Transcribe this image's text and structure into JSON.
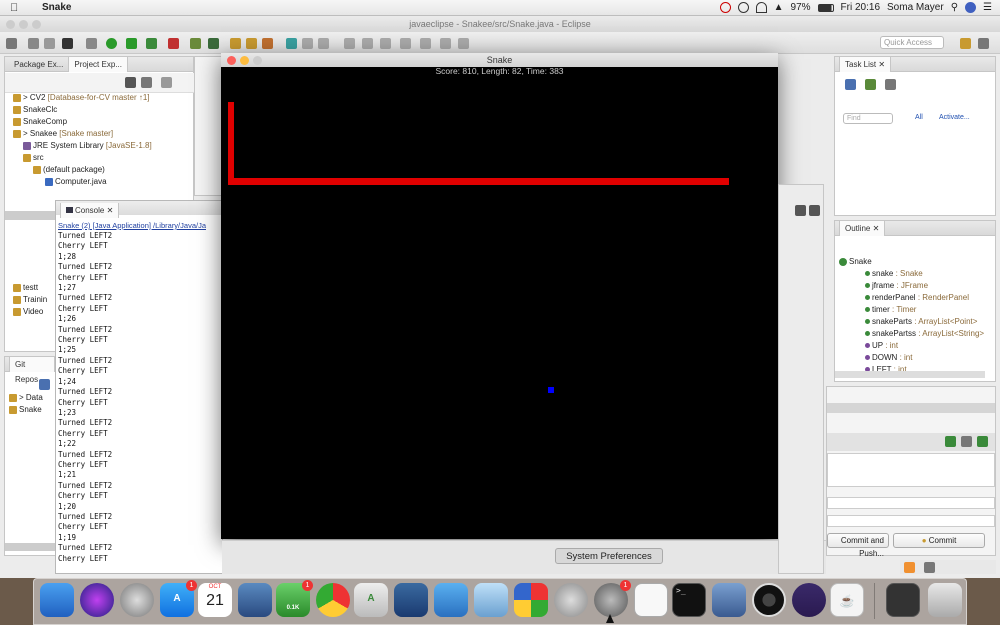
{
  "menubar": {
    "app_name": "Snake",
    "battery": "97%",
    "clock": "Fri 20:16",
    "user": "Soma Mayer"
  },
  "eclipse": {
    "window_title": "javaeclipse - Snakee/src/Snake.java - Eclipse",
    "quick_access": "Quick Access"
  },
  "package_explorer": {
    "tabs": [
      "Package Ex...",
      "Project Exp..."
    ],
    "rows": [
      {
        "label": "> CV2",
        "meta": "[Database-for-CV master ↑1]"
      },
      {
        "label": "SnakeClc",
        "meta": ""
      },
      {
        "label": "SnakeComp",
        "meta": ""
      },
      {
        "label": "> Snakee",
        "meta": "[Snake master]"
      },
      {
        "label": "JRE System Library",
        "meta": "[JavaSE-1.8]"
      },
      {
        "label": "src",
        "meta": ""
      },
      {
        "label": "(default package)",
        "meta": ""
      },
      {
        "label": "Computer.java",
        "meta": ""
      }
    ],
    "lower_rows": [
      "testt",
      "Trainin",
      "Video"
    ]
  },
  "git": {
    "tab": "Git Repos",
    "rows": [
      "> Data",
      "Snake"
    ]
  },
  "console": {
    "tab": "Console",
    "header": "Snake (2) [Java Application] /Library/Java/Ja",
    "lines": [
      "Turned LEFT2",
      "Cherry LEFT",
      "1;28",
      "Turned LEFT2",
      "Cherry LEFT",
      "1;27",
      "Turned LEFT2",
      "Cherry LEFT",
      "1;26",
      "Turned LEFT2",
      "Cherry LEFT",
      "1;25",
      "Turned LEFT2",
      "Cherry LEFT",
      "1;24",
      "Turned LEFT2",
      "Cherry LEFT",
      "1;23",
      "Turned LEFT2",
      "Cherry LEFT",
      "1;22",
      "Turned LEFT2",
      "Cherry LEFT",
      "1;21",
      "Turned LEFT2",
      "Cherry LEFT",
      "1;20",
      "Turned LEFT2",
      "Cherry LEFT",
      "1;19",
      "Turned LEFT2",
      "Cherry LEFT"
    ]
  },
  "snake_window": {
    "title": "Snake",
    "status": "Score: 810, Length: 82, Time: 383"
  },
  "task_list": {
    "tab": "Task List",
    "find_placeholder": "Find",
    "links": [
      "All",
      "Activate..."
    ]
  },
  "outline": {
    "tab": "Outline",
    "root": "Snake",
    "items": [
      {
        "name": "snake",
        "type": ": Snake"
      },
      {
        "name": "jframe",
        "type": ": JFrame"
      },
      {
        "name": "renderPanel",
        "type": ": RenderPanel"
      },
      {
        "name": "timer",
        "type": ": Timer"
      },
      {
        "name": "snakeParts",
        "type": ": ArrayList<Point>"
      },
      {
        "name": "snakePartss",
        "type": ": ArrayList<String>"
      },
      {
        "name": "UP",
        "type": ": int"
      },
      {
        "name": "DOWN",
        "type": ": int"
      },
      {
        "name": "LEFT",
        "type": ": int"
      }
    ]
  },
  "git_staging": {
    "commit_and_push": "Commit and Push...",
    "commit": "Commit"
  },
  "tooltip": "System Preferences",
  "dock": {
    "calendar_month": "OCT",
    "calendar_day": "21",
    "badge_utorrent": "1",
    "badge_appstore": "1",
    "badge_sysprefs": "1",
    "utorrent_rate": "0.1K",
    "terminal_glyph": ">_"
  },
  "colors": {
    "snake_body": "#e00000",
    "cherry": "#0000ff",
    "game_bg": "#000000"
  }
}
